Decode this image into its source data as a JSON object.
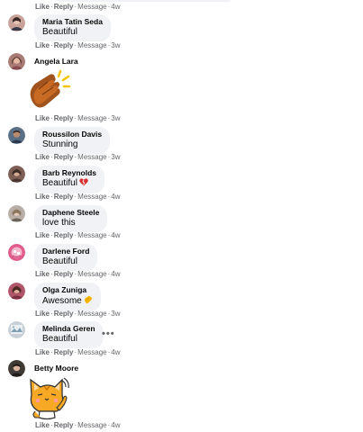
{
  "actions": {
    "like": "Like",
    "reply": "Reply",
    "message": "Message",
    "dot": "·"
  },
  "top_action_time": "4w",
  "comments": [
    {
      "name": "Maria Tatin Seda",
      "text": "Beautiful",
      "time": "3w"
    },
    {
      "name": "Angela Lara",
      "text": "",
      "time": "3w",
      "sticker": "clapping-hands-sticker"
    },
    {
      "name": "Roussilon Davis",
      "text": "Stunning",
      "time": "3w"
    },
    {
      "name": "Barb Reynolds",
      "text": "Beautiful",
      "time": "4w",
      "emoji": "broken-heart"
    },
    {
      "name": "Daphene Steele",
      "text": "love this",
      "time": "4w"
    },
    {
      "name": "Darlene Ford",
      "text": "Beautiful",
      "time": "4w"
    },
    {
      "name": "Olga Zuniga",
      "text": "Awesome",
      "time": "3w",
      "emoji": "clapping-hands"
    },
    {
      "name": "Melinda Geren",
      "text": "Beautiful",
      "time": "4w",
      "more": "•••"
    },
    {
      "name": "Betty Moore",
      "text": "",
      "time": "4w",
      "sticker": "waving-cat-sticker"
    }
  ],
  "colors": {
    "bubble": "#f0f2f5",
    "meta": "#65676b",
    "text": "#050505"
  }
}
